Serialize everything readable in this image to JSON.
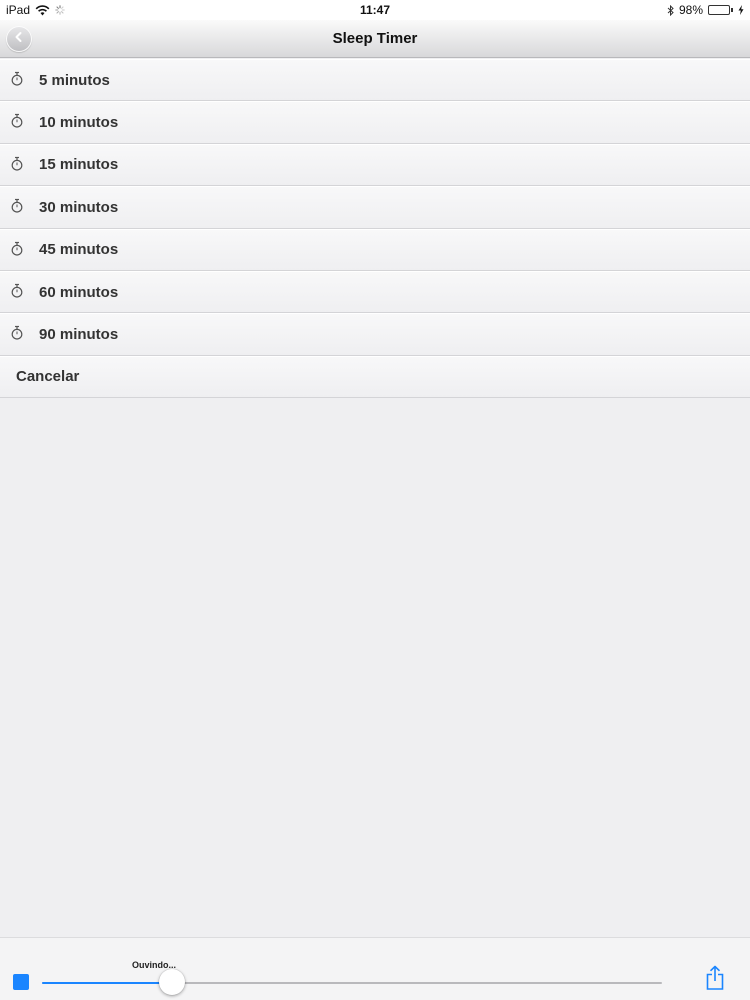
{
  "status_bar": {
    "device": "iPad",
    "time": "11:47",
    "battery_percent": "98%",
    "battery_level": 0.98,
    "battery_color": "#4cd964",
    "icons": [
      "wifi-icon",
      "activity-spinner-icon",
      "bluetooth-icon",
      "battery-icon",
      "charging-bolt-icon"
    ]
  },
  "nav": {
    "title": "Sleep Timer",
    "back_icon": "chevron-left-icon"
  },
  "list": {
    "items": [
      {
        "label": "5 minutos",
        "icon": "stopwatch-icon"
      },
      {
        "label": "10 minutos",
        "icon": "stopwatch-icon"
      },
      {
        "label": "15 minutos",
        "icon": "stopwatch-icon"
      },
      {
        "label": "30 minutos",
        "icon": "stopwatch-icon"
      },
      {
        "label": "45 minutos",
        "icon": "stopwatch-icon"
      },
      {
        "label": "60 minutos",
        "icon": "stopwatch-icon"
      },
      {
        "label": "90 minutos",
        "icon": "stopwatch-icon"
      }
    ],
    "cancel_label": "Cancelar"
  },
  "player": {
    "status_text": "Ouvindo...",
    "progress": 0.21,
    "accent_color": "#1a85ff",
    "stop_icon": "stop-icon",
    "share_icon": "share-icon"
  }
}
